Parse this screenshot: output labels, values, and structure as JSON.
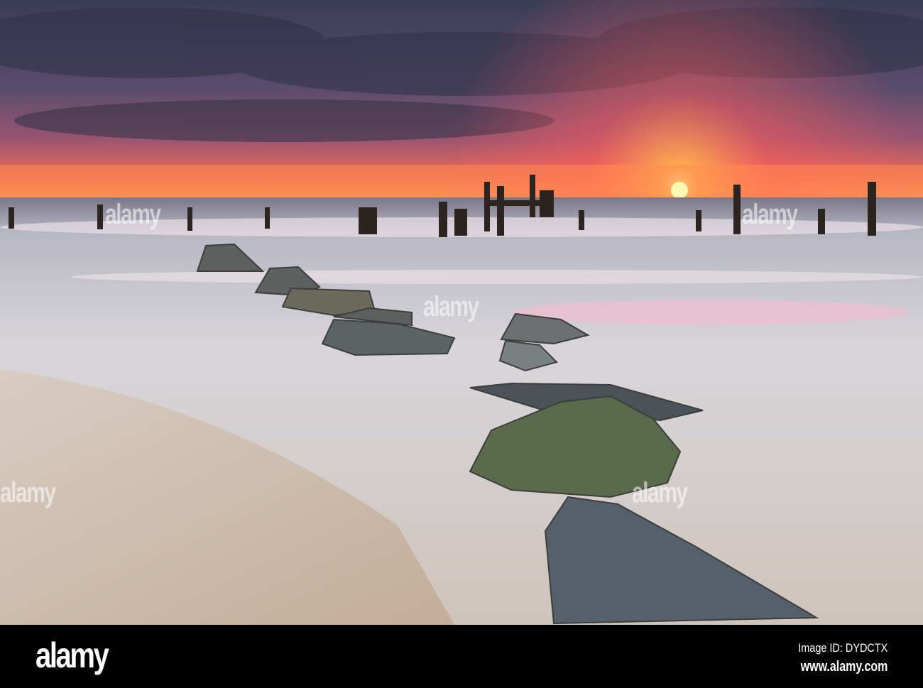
{
  "photo": {
    "description_colors": {
      "sun": "#ffe27a",
      "sky_top": "#3d3f5c",
      "horizon": "#ff7a4a",
      "sea": "#8a8d9c",
      "sand": "#c9b6a4"
    },
    "watermark": "alamy"
  },
  "footer": {
    "logo": "alamy",
    "image_id": "Image ID: DYDCTX",
    "url": "www.alamy.com"
  }
}
